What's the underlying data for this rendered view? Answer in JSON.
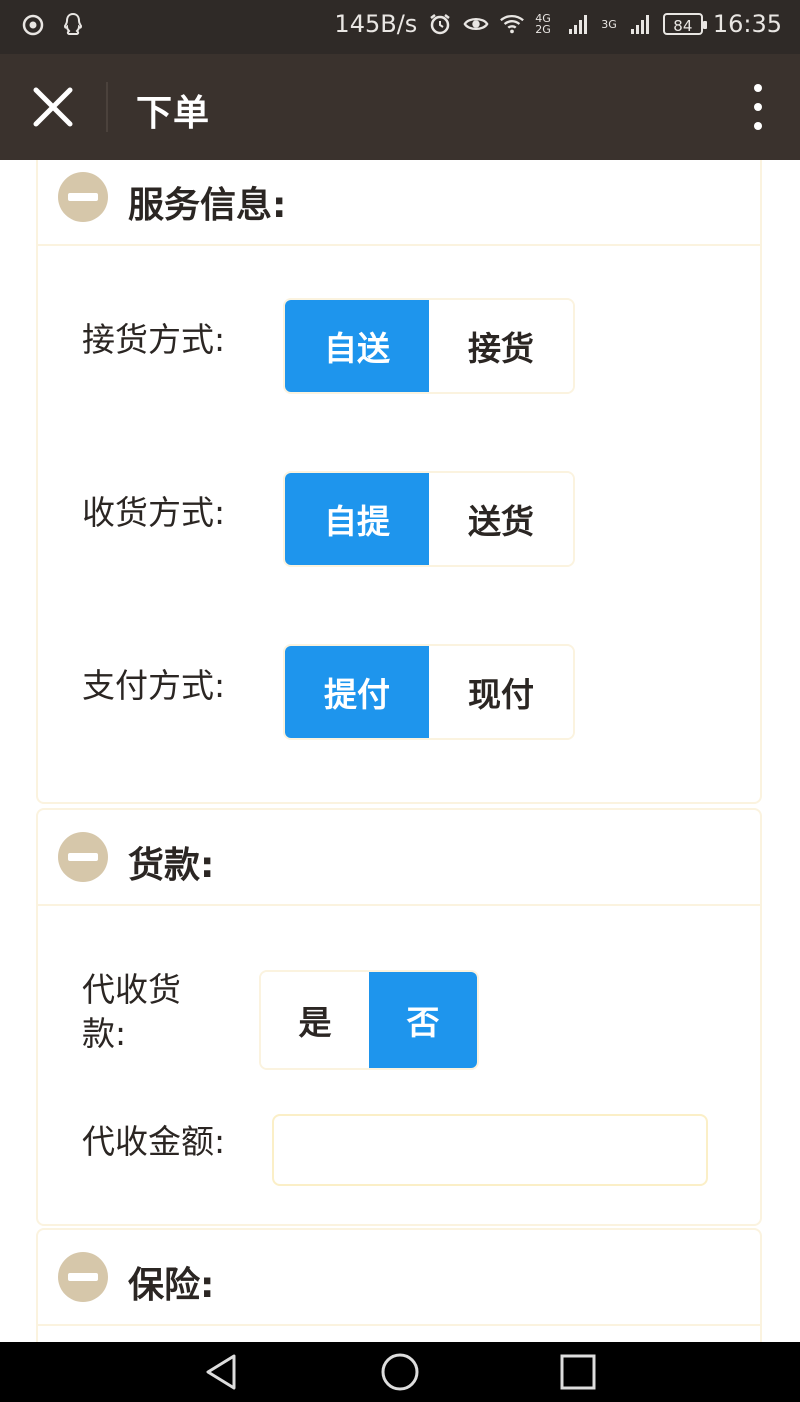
{
  "status_bar": {
    "net_speed": "145B/s",
    "network_1": "4G 2G",
    "network_2": "3G",
    "battery": "84",
    "time": "16:35"
  },
  "header": {
    "title": "下单"
  },
  "sections": {
    "service": {
      "title": "服务信息:",
      "pickup_label": "接货方式:",
      "pickup_options": [
        "自送",
        "接货"
      ],
      "delivery_label": "收货方式:",
      "delivery_options": [
        "自提",
        "送货"
      ],
      "payment_label": "支付方式:",
      "payment_options": [
        "提付",
        "现付"
      ]
    },
    "payment_goods": {
      "title": "货款:",
      "cod_label_line1": "代收货",
      "cod_label_line2": "款:",
      "cod_options": [
        "是",
        "否"
      ],
      "amount_label": "代收金额:",
      "amount_value": ""
    },
    "insurance": {
      "title": "保险:"
    }
  },
  "colors": {
    "accent": "#1e95ed",
    "header_bg": "#3a322d",
    "status_bg": "#2f2a27",
    "icon_bg": "#d6c7aa"
  }
}
